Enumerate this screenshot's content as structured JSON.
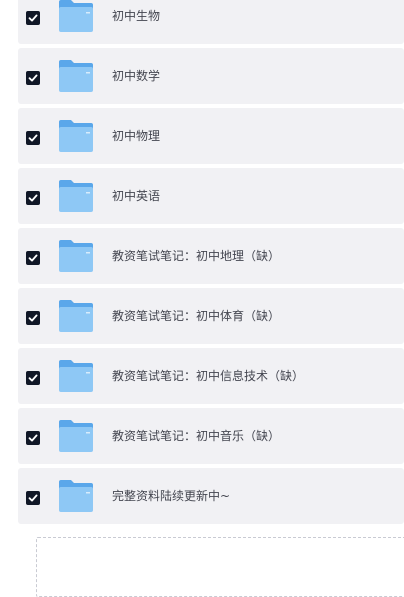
{
  "items": [
    {
      "label": "初中生物",
      "checked": true
    },
    {
      "label": "初中数学",
      "checked": true
    },
    {
      "label": "初中物理",
      "checked": true
    },
    {
      "label": "初中英语",
      "checked": true
    },
    {
      "label": "教资笔试笔记：初中地理（缺）",
      "checked": true
    },
    {
      "label": "教资笔试笔记：初中体育（缺）",
      "checked": true
    },
    {
      "label": "教资笔试笔记：初中信息技术（缺）",
      "checked": true
    },
    {
      "label": "教资笔试笔记：初中音乐（缺）",
      "checked": true
    },
    {
      "label": "完整资料陆续更新中~",
      "checked": true
    }
  ],
  "colors": {
    "row_bg": "#f1f1f4",
    "checkbox": "#111827",
    "folder_light": "#8ec8f5",
    "folder_dark": "#5aa7ea",
    "text": "#444650"
  },
  "icons": {
    "checkbox": "checkbox-checked-icon",
    "folder": "folder-icon"
  }
}
